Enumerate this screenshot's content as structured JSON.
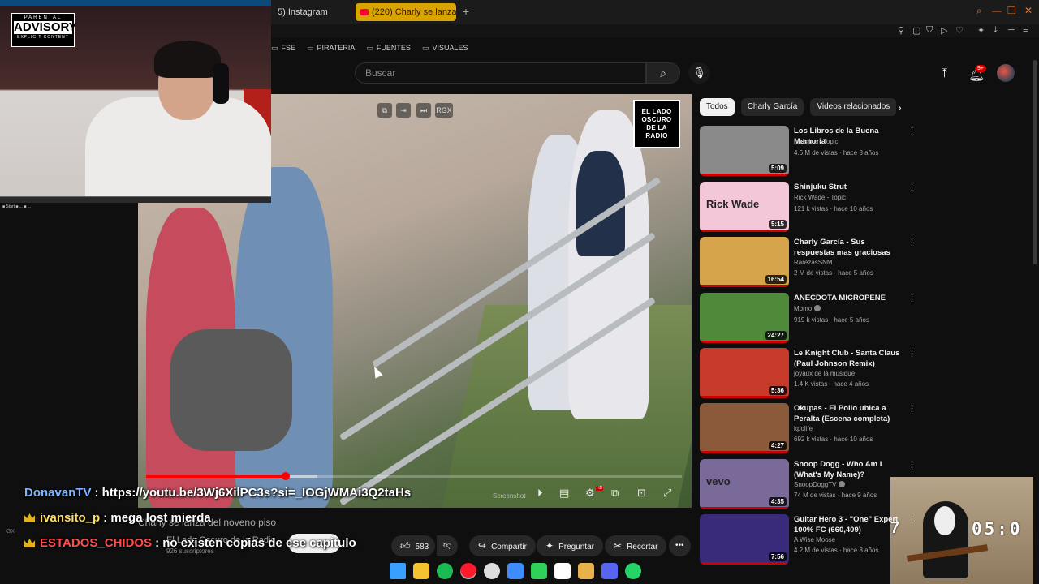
{
  "browser": {
    "tabs": [
      {
        "label": "5) Instagram",
        "active": false
      },
      {
        "label": "(220) Charly se lanza",
        "active": true
      }
    ],
    "bookmarks": [
      "FSE",
      "PIRATERIA",
      "FUENTES",
      "VISUALES"
    ]
  },
  "youtube": {
    "search_placeholder": "Buscar",
    "notification_count": "9+"
  },
  "player": {
    "overlay_buttons": [
      "⧉",
      "⇥",
      "⏭",
      "RGX"
    ],
    "channel_logo_lines": [
      "EL LADO",
      "OSCURO",
      "DE LA",
      "RADIO"
    ],
    "progress_fraction": 0.26,
    "buffer_fraction": 0.32,
    "screenshot_label": "Screenshot",
    "hd_badge": "HD"
  },
  "video": {
    "title": "Charly se lanza del noveno piso",
    "channel": "El Lado Oscuro de la Radio",
    "subscribers": "926 suscriptores",
    "likes": "583",
    "share_label": "Compartir",
    "ask_label": "Preguntar",
    "clip_label": "Recortar"
  },
  "chat": [
    {
      "user": "DonavanTV",
      "message": ": https://youtu.be/3Wj6XilPC3s?si=_IOGjWMAi3Q2taHs",
      "color": "#7fb4ff",
      "badge": false
    },
    {
      "user": "ivansito_p",
      "message": ": mega lost mierda",
      "color": "#ffe066",
      "badge": true
    },
    {
      "user": "ESTADOS_CHIDOS",
      "message": ": no existen copias de ese capitulo",
      "color": "#ff4d4d",
      "badge": true
    }
  ],
  "chat_side_label": "GX",
  "webcam": {
    "advisory_top": "PARENTAL",
    "advisory_main": "ADVISORY",
    "advisory_bottom": "EXPLICIT CONTENT",
    "strip_label": "■ Start  ■ ...  ■ ..."
  },
  "game_overlay": {
    "timer": "05:0",
    "left_digit": "7"
  },
  "sidebar": {
    "chips": [
      {
        "label": "Todos",
        "active": true
      },
      {
        "label": "Charly García",
        "active": false
      },
      {
        "label": "Videos relacionados",
        "active": false
      }
    ],
    "videos": [
      {
        "title": "Los Libros de la Buena Memoria",
        "channel": "Invisible - Topic",
        "meta": "4.6 M de vistas · hace 8 años",
        "duration": "5:09",
        "thumb": "#8a8a8a",
        "verified": false
      },
      {
        "title": "Shinjuku Strut",
        "channel": "Rick Wade - Topic",
        "meta": "121 k vistas · hace 10 años",
        "duration": "5:15",
        "thumb": "#f3c6d8",
        "thumb_text": "Rick Wade",
        "verified": false
      },
      {
        "title": "Charly García - Sus respuestas mas graciosas",
        "channel": "RarezasSNM",
        "meta": "2 M de vistas · hace 5 años",
        "duration": "16:54",
        "thumb": "#d6a44a",
        "verified": false
      },
      {
        "title": "ANECDOTA MICROPENE",
        "channel": "Momo",
        "meta": "919 k vistas · hace 5 años",
        "duration": "24:27",
        "thumb": "#4f8a3a",
        "verified": true
      },
      {
        "title": "Le Knight Club - Santa Claus (Paul Johnson Remix)",
        "channel": "joyaux de la musique",
        "meta": "1.4 K vistas · hace 4 años",
        "duration": "5:36",
        "thumb": "#c83a2a",
        "verified": false
      },
      {
        "title": "Okupas - El Pollo ubica a Peralta (Escena completa)",
        "channel": "kpolife",
        "meta": "692 k vistas · hace 10 años",
        "duration": "4:27",
        "thumb": "#8a5a3a",
        "verified": false
      },
      {
        "title": "Snoop Dogg - Who Am I (What's My Name)?",
        "channel": "SnoopDoggTV",
        "meta": "74 M de vistas · hace 9 años",
        "duration": "4:35",
        "thumb": "#7a6a9a",
        "thumb_text": "vevo",
        "verified": true
      },
      {
        "title": "Guitar Hero 3 - \"One\" Expert 100% FC (660,409)",
        "channel": "A Wise Moose",
        "meta": "4.2 M de vistas · hace 8 años",
        "duration": "7:56",
        "thumb": "#3a2a7a",
        "verified": false
      }
    ]
  },
  "taskbar": {
    "apps": [
      {
        "name": "windows-start",
        "color": "#3aa0ff"
      },
      {
        "name": "file-explorer",
        "color": "#f4c430"
      },
      {
        "name": "spotify",
        "color": "#1db954"
      },
      {
        "name": "opera",
        "color": "#ff1b2d"
      },
      {
        "name": "obs",
        "color": "#dddddd"
      },
      {
        "name": "app-blue",
        "color": "#3f8cff"
      },
      {
        "name": "app-green",
        "color": "#2fd15a"
      },
      {
        "name": "github",
        "color": "#ffffff"
      },
      {
        "name": "app-gold",
        "color": "#e8b24a"
      },
      {
        "name": "discord",
        "color": "#5865f2"
      },
      {
        "name": "whatsapp",
        "color": "#25d366"
      }
    ]
  }
}
